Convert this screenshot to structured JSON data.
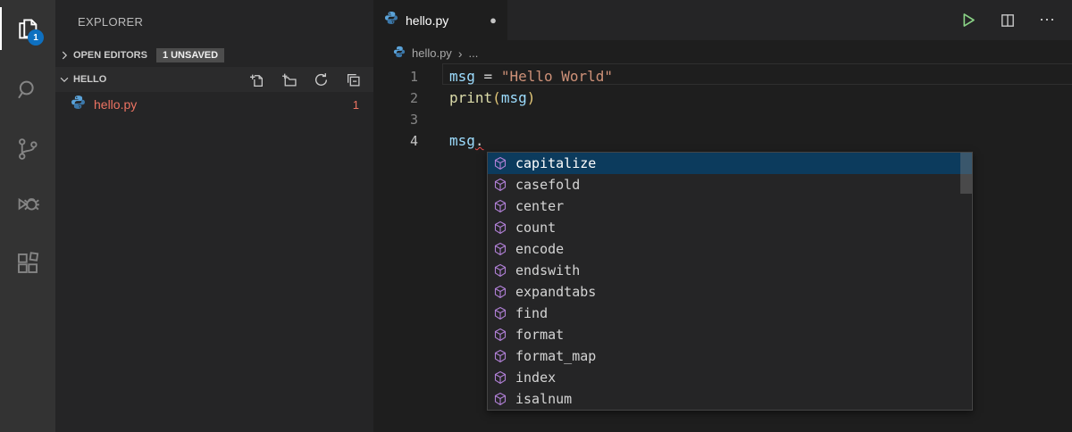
{
  "activity_bar": {
    "explorer_badge": "1"
  },
  "sidebar": {
    "title": "EXPLORER",
    "open_editors": {
      "label": "OPEN EDITORS",
      "badge": "1 UNSAVED"
    },
    "folder": {
      "name": "HELLO"
    },
    "file": {
      "name": "hello.py",
      "problems": "1"
    }
  },
  "editor": {
    "tab": {
      "title": "hello.py",
      "dirty_dot": "●"
    },
    "actions": {
      "more": "⋯"
    },
    "breadcrumb": {
      "file": "hello.py",
      "sep": "›",
      "ellipsis": "..."
    },
    "line_numbers": [
      "1",
      "2",
      "3",
      "4"
    ],
    "code": {
      "line1": {
        "var": "msg",
        "op": " = ",
        "str": "\"Hello World\""
      },
      "line2": {
        "func": "print",
        "open": "(",
        "arg": "msg",
        "close": ")"
      },
      "line4": {
        "var": "msg",
        "dot": "."
      }
    }
  },
  "suggest": {
    "items": [
      {
        "label": "capitalize"
      },
      {
        "label": "casefold"
      },
      {
        "label": "center"
      },
      {
        "label": "count"
      },
      {
        "label": "encode"
      },
      {
        "label": "endswith"
      },
      {
        "label": "expandtabs"
      },
      {
        "label": "find"
      },
      {
        "label": "format"
      },
      {
        "label": "format_map"
      },
      {
        "label": "index"
      },
      {
        "label": "isalnum"
      }
    ]
  },
  "colors": {
    "activity_bar_bg": "#333333",
    "sidebar_bg": "#252526",
    "editor_bg": "#1e1e1e",
    "badge_blue": "#0e70c0",
    "error_file": "#ed7362",
    "string": "#ce9178",
    "variable": "#9cdcfe",
    "function": "#dcdcaa",
    "method_icon": "#b180d7",
    "suggest_selection": "#0c3b5d",
    "run_green": "#89d185",
    "squiggle": "#f14c4c"
  }
}
